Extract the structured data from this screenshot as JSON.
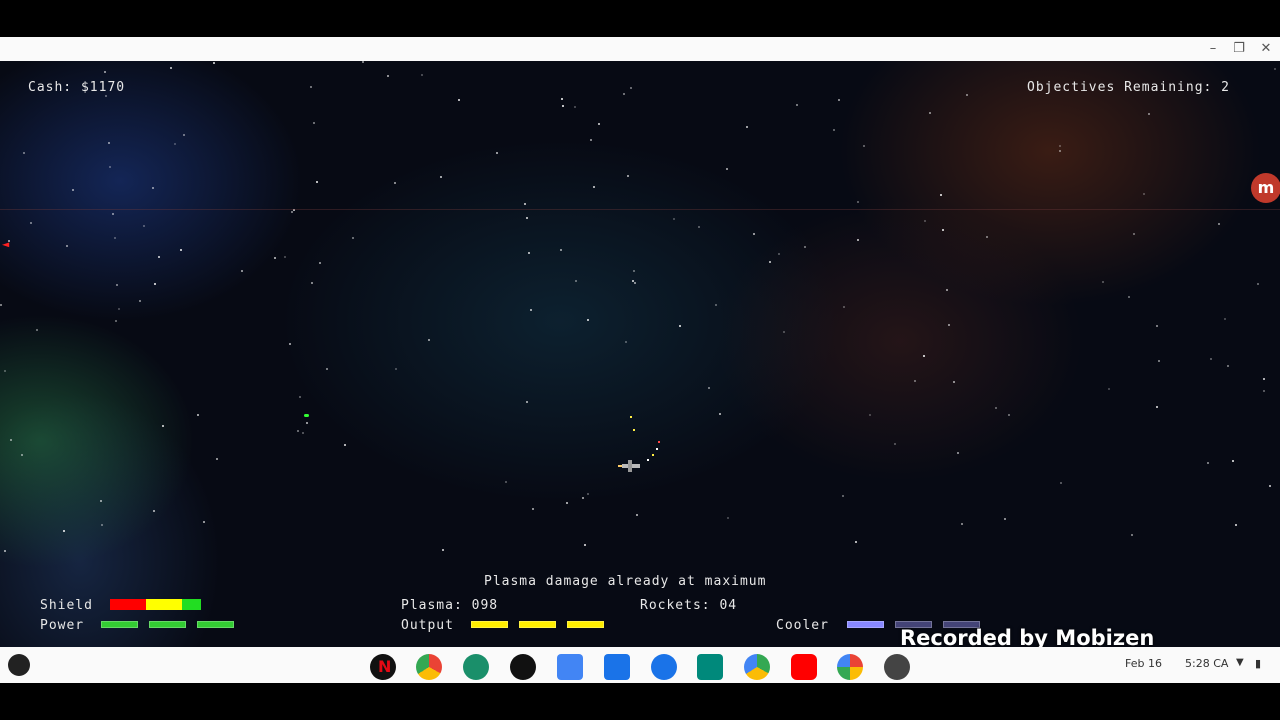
{
  "window": {
    "minimize_icon": "minimize-icon",
    "restore_icon": "restore-icon",
    "close_icon": "close-icon"
  },
  "hud": {
    "cash": "Cash: $1170",
    "objectives": "Objectives Remaining: 2",
    "message": "Plasma damage already at maximum",
    "shield_label": "Shield",
    "power_label": "Power",
    "plasma_label": "Plasma: 098",
    "output_label": "Output",
    "rockets_label": "Rockets: 04",
    "cooler_label": "Cooler"
  },
  "colors": {
    "shield_red": "#ff0000",
    "shield_yellow": "#ffff00",
    "shield_green": "#22dd22",
    "power": "#33cc33",
    "output": "#ffee00",
    "cooler": "#8888ff"
  },
  "overlay": {
    "recorded": "Recorded by Mobizen"
  },
  "taskbar": {
    "apps": [
      "netflix-icon",
      "chrome-icon",
      "app-grid-icon",
      "gallery-icon",
      "calendar-icon",
      "files-icon",
      "messages-icon",
      "meet-icon",
      "play-store-icon",
      "youtube-icon",
      "photos-icon",
      "game-icon"
    ],
    "date": "Feb 16",
    "time": "5:28 CA"
  }
}
